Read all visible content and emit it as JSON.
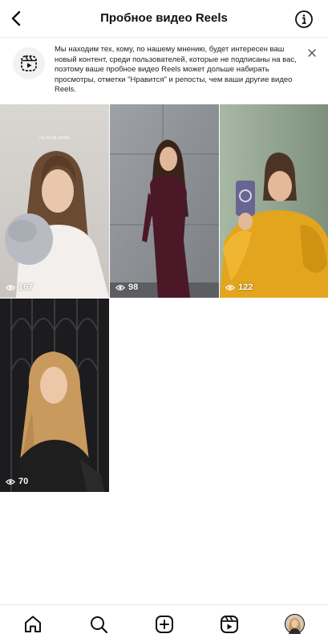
{
  "header": {
    "title": "Пробное видео Reels"
  },
  "banner": {
    "text": "Мы находим тех, кому, по нашему мнению, будет интересен ваш новый контент, среди пользователей, которые не подписаны на вас, поэтому ваше пробное видео Reels может дольше набирать просмотры, отметки \"Нравится\" и репосты, чем ваши другие видео Reels."
  },
  "reels": [
    {
      "views": "167",
      "caption": "my fav lip combo"
    },
    {
      "views": "98"
    },
    {
      "views": "122"
    },
    {
      "views": "70"
    }
  ],
  "icons": {
    "back": "chevron-left-icon",
    "info": "info-circle-icon",
    "banner": "reels-icon",
    "close": "close-icon",
    "views": "eye-icon",
    "tabs": [
      "home-icon",
      "search-icon",
      "create-icon",
      "reels-icon",
      "profile-avatar"
    ]
  }
}
